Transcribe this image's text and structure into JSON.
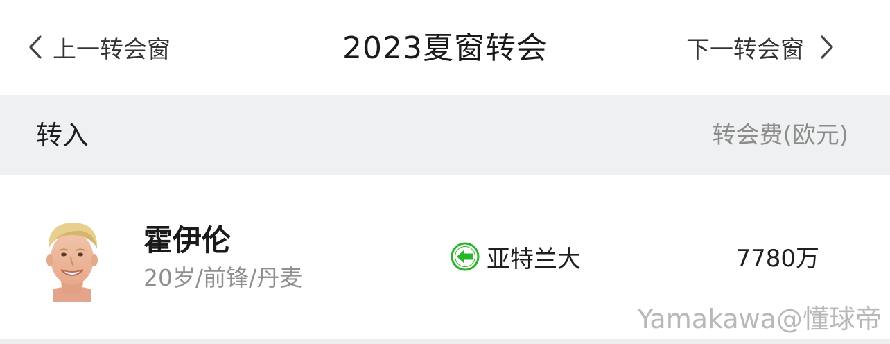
{
  "nav": {
    "prev_label": "上一转会窗",
    "title": "2023夏窗转会",
    "next_label": "下一转会窗"
  },
  "section": {
    "title": "转入",
    "fee_header": "转会费(欧元)"
  },
  "transfers": [
    {
      "name": "霍伊伦",
      "meta": "20岁/前锋/丹麦",
      "direction_icon": "green-left-arrow-icon",
      "club": "亚特兰大",
      "fee": "7780万"
    }
  ],
  "watermark": "Yamakawa@懂球帝",
  "colors": {
    "section_bg": "#eff0f1",
    "secondary_text": "#8c8c8c",
    "arrow_green": "#2bb52b"
  }
}
